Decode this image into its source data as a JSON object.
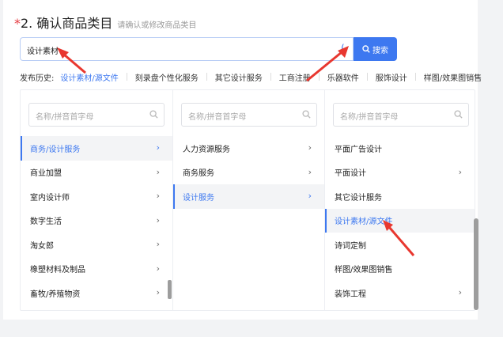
{
  "section": {
    "required_mark": "*",
    "title": "2. 确认商品类目",
    "subtitle": "请确认或修改商品类目"
  },
  "search": {
    "value": "设计素材",
    "button_label": "搜索",
    "loading_glyph": "("
  },
  "history": {
    "label": "发布历史:",
    "items": [
      "设计素材/源文件",
      "刻录盘个性化服务",
      "其它设计服务",
      "工商注册",
      "乐器软件",
      "服饰设计",
      "样图/效果图销售"
    ]
  },
  "columns": [
    {
      "filter_placeholder": "名称/拼音首字母",
      "items": [
        {
          "label": "商务/设计服务",
          "has_children": true,
          "selected": true
        },
        {
          "label": "商业加盟",
          "has_children": true
        },
        {
          "label": "室内设计师",
          "has_children": true
        },
        {
          "label": "数字生活",
          "has_children": true
        },
        {
          "label": "淘女郎",
          "has_children": true
        },
        {
          "label": "橡塑材料及制品",
          "has_children": true
        },
        {
          "label": "畜牧/养殖物资",
          "has_children": true
        }
      ]
    },
    {
      "filter_placeholder": "名称/拼音首字母",
      "items": [
        {
          "label": "人力资源服务",
          "has_children": true
        },
        {
          "label": "商务服务",
          "has_children": true
        },
        {
          "label": "设计服务",
          "has_children": true,
          "selected": true
        }
      ]
    },
    {
      "filter_placeholder": "名称/拼音首字母",
      "items": [
        {
          "label": "平面广告设计",
          "has_children": false
        },
        {
          "label": "平面设计",
          "has_children": true
        },
        {
          "label": "其它设计服务",
          "has_children": false
        },
        {
          "label": "设计素材/源文件",
          "has_children": false,
          "selected": true
        },
        {
          "label": "诗词定制",
          "has_children": false
        },
        {
          "label": "样图/效果图销售",
          "has_children": false
        },
        {
          "label": "装饰工程",
          "has_children": true
        }
      ]
    }
  ],
  "icons": {
    "search_icon": "search-icon",
    "chevron": "chevron-right-icon",
    "annotation_arrow": "red-arrow-annotation"
  },
  "colors": {
    "accent": "#3d78f0",
    "required": "#e5393f",
    "annotation": "#e8372f"
  }
}
